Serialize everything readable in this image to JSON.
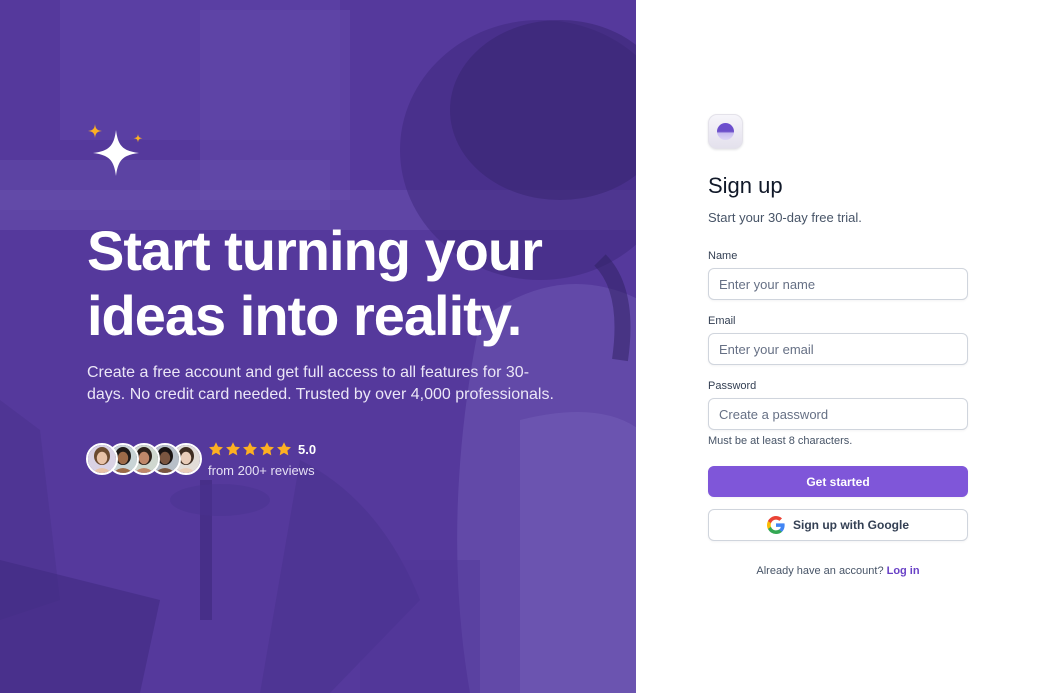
{
  "hero": {
    "headline": "Start turning your ideas into reality.",
    "subtext": "Create a free account and get full access to all features for 30-days. No credit card needed. Trusted by over 4,000 professionals.",
    "rating": {
      "score": "5.0",
      "stars": 5,
      "count_text": "from 200+ reviews"
    },
    "avatars": [
      {
        "name": "avatar-1",
        "skin": "#e8c2a7",
        "hair": "#6b4a2f",
        "bg": "#d9d2e4"
      },
      {
        "name": "avatar-2",
        "skin": "#9c6a48",
        "hair": "#1f1a18",
        "bg": "#c9d4d6"
      },
      {
        "name": "avatar-3",
        "skin": "#c0876a",
        "hair": "#2d211c",
        "bg": "#cfd7cf"
      },
      {
        "name": "avatar-4",
        "skin": "#7a5540",
        "hair": "#1a1414",
        "bg": "#b7bfc8"
      },
      {
        "name": "avatar-5",
        "skin": "#e9ccb8",
        "hair": "#3f2d22",
        "bg": "#e2ddd8"
      }
    ],
    "colors": {
      "panel": "#55399c",
      "star": "#fdb022",
      "sparkle_accent": "#fdb022"
    }
  },
  "form": {
    "title": "Sign up",
    "subtitle": "Start your 30-day free trial.",
    "name": {
      "label": "Name",
      "placeholder": "Enter your name",
      "value": ""
    },
    "email": {
      "label": "Email",
      "placeholder": "Enter your email",
      "value": ""
    },
    "password": {
      "label": "Password",
      "placeholder": "Create a password",
      "value": "",
      "hint": "Must be at least 8 characters."
    },
    "submit_label": "Get started",
    "google_label": "Sign up with Google",
    "login_prompt": "Already have an account?",
    "login_link": "Log in",
    "colors": {
      "primary": "#7f56d9",
      "link": "#6941c6"
    }
  }
}
